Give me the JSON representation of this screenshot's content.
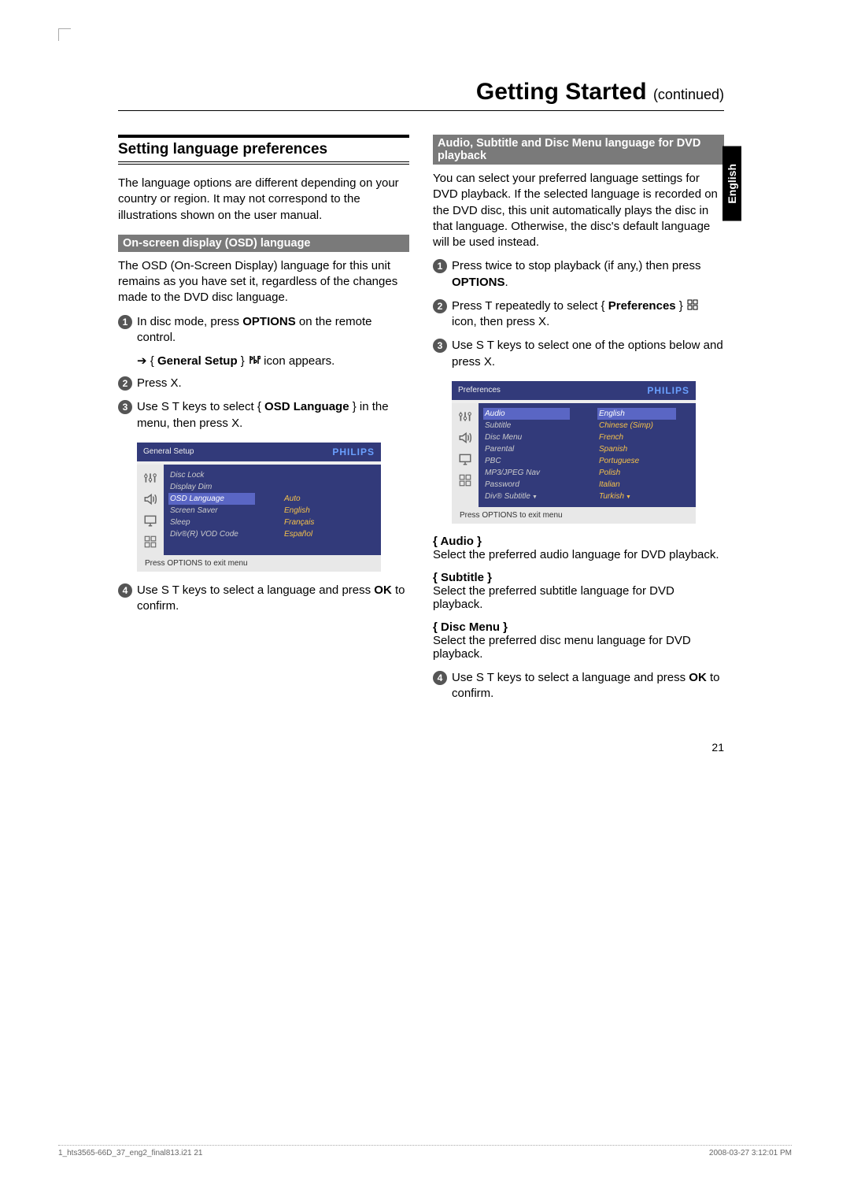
{
  "title_main": "Getting Started",
  "title_sub": "(continued)",
  "lang_tab": "English",
  "section_heading": "Setting language preferences",
  "intro": "The language options are different depending on your country or region. It may not correspond to the illustrations shown on the user manual.",
  "osd_head": "On-screen display (OSD) language",
  "osd_para": "The OSD (On-Screen Display) language for this unit remains as you have set it, regardless of the changes made to the DVD disc language.",
  "osd_step1_a": "In disc mode, press ",
  "osd_step1_b": "OPTIONS",
  "osd_step1_c": " on the remote control.",
  "osd_step1_bullet_a": "{ ",
  "osd_step1_bullet_b": "General Setup",
  "osd_step1_bullet_c": " }  ",
  "osd_step1_bullet_d": " icon appears.",
  "osd_step2": "Press  X.",
  "osd_step3_a": "Use  S T keys to select { ",
  "osd_step3_b": "OSD Language",
  "osd_step3_c": " } in the menu, then press  X.",
  "osd_step4_a": "Use  S T keys to select a language and press ",
  "osd_step4_b": "OK",
  "osd_step4_c": " to confirm.",
  "menu1": {
    "title": "General Setup",
    "brand": "PHILIPS",
    "items": [
      "Disc Lock",
      "Display Dim",
      "OSD Language",
      "Screen Saver",
      "Sleep",
      "Div®(R) VOD Code"
    ],
    "highlight_index": 2,
    "options": [
      "Auto",
      "English",
      "Français",
      "Español"
    ],
    "footer": "Press OPTIONS to exit menu"
  },
  "dvd_head": "Audio, Subtitle and Disc Menu language for DVD playback",
  "dvd_para": "You can select your preferred language settings for DVD playback. If the selected language is recorded on the DVD disc, this unit automatically plays the disc in that language. Otherwise, the disc's default language will be used instead.",
  "dvd_step1_a": "Press  twice to stop playback (if any,) then press ",
  "dvd_step1_b": "OPTIONS",
  "dvd_step1_c": ".",
  "dvd_step2_a": "Press  T repeatedly to select { ",
  "dvd_step2_b": "Preferences",
  "dvd_step2_c": " }  ",
  "dvd_step2_d": " icon, then press  X.",
  "dvd_step3": "Use  S T keys to select one of the options below and press  X.",
  "menu2": {
    "title": "Preferences",
    "brand": "PHILIPS",
    "items": [
      "Audio",
      "Subtitle",
      "Disc Menu",
      "Parental",
      "PBC",
      "MP3/JPEG Nav",
      "Password",
      "Div® Subtitle"
    ],
    "highlight_index": 0,
    "options": [
      "English",
      "Chinese (Simp)",
      "French",
      "Spanish",
      "Portuguese",
      "Polish",
      "Italian",
      "Turkish"
    ],
    "options_highlight_index": 0,
    "footer": "Press OPTIONS to exit menu"
  },
  "defs": {
    "audio_label": "{ Audio }",
    "audio_text": "Select the preferred audio language for DVD playback.",
    "subtitle_label": "{ Subtitle }",
    "subtitle_text": "Select the preferred subtitle language for DVD playback.",
    "discmenu_label": "{ Disc Menu }",
    "discmenu_text": "Select the preferred disc menu language for DVD playback."
  },
  "step4_repeat_a": "Use  S T keys to select a language and press ",
  "step4_repeat_b": "OK",
  "step4_repeat_c": " to confirm.",
  "page_number": "21",
  "footer_left": "1_hts3565-66D_37_eng2_final813.i21   21",
  "footer_right": "2008-03-27   3:12:01 PM"
}
